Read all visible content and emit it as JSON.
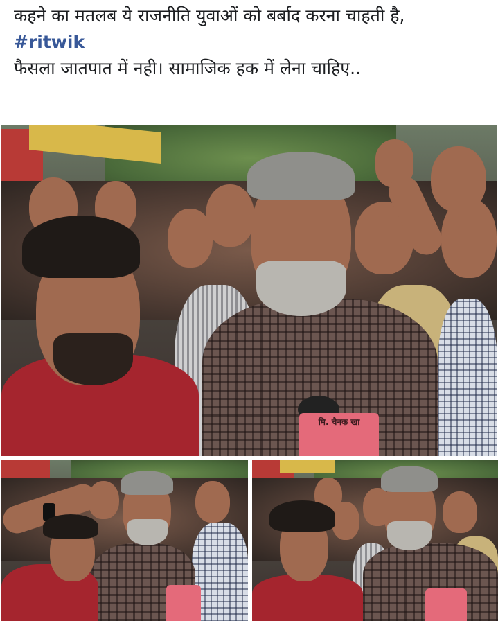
{
  "post": {
    "line1": "कहने का मतलब ये राजनीति युवाओं को बर्बाद करना चाहती है,",
    "hashtag": "#ritwik",
    "line3": "फैसला जातपात में नही। सामाजिक हक में लेना चाहिए.."
  },
  "photos": {
    "main": {
      "mic_label": "मि. चैनक खा"
    }
  },
  "colors": {
    "post_text": "#1c1e21",
    "hashtag": "#385898",
    "background": "#ffffff"
  }
}
